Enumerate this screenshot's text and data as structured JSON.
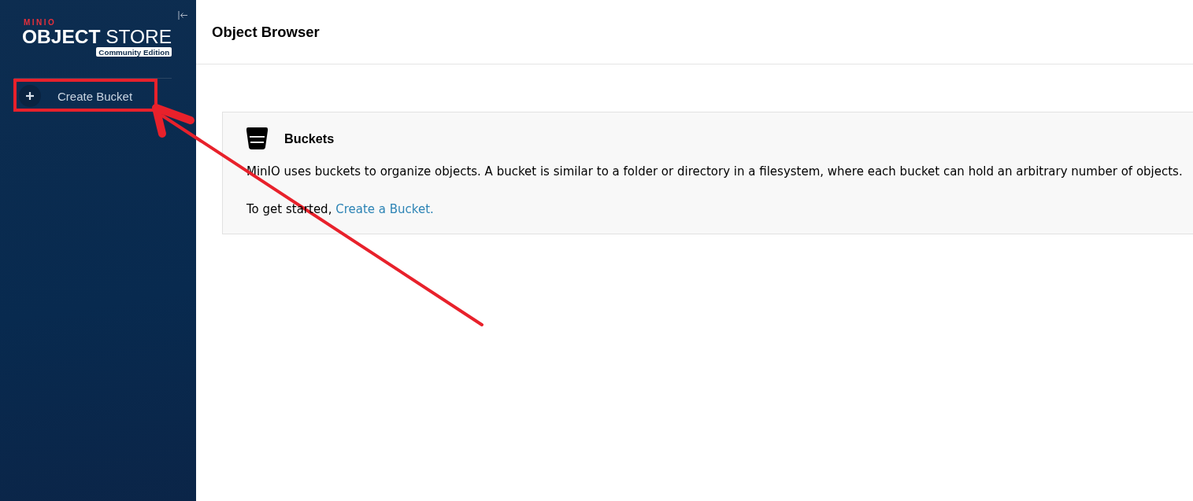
{
  "sidebar": {
    "logo": {
      "brand": "MINIO",
      "title": "**OBJECT** STORE",
      "edition": "Community Edition"
    },
    "menu": [
      {
        "label": "Create Bucket"
      }
    ]
  },
  "header": {
    "title": "Object Browser"
  },
  "buckets_card": {
    "title": "Buckets",
    "description": "MinIO uses buckets to organize objects. A bucket is similar to a folder or directory in a filesystem, where each bucket can hold an arbitrary number of objects.",
    "prompt": "To get started,",
    "link": "Create a Bucket."
  },
  "annotation": {
    "highlight_box": true,
    "arrow": true
  }
}
